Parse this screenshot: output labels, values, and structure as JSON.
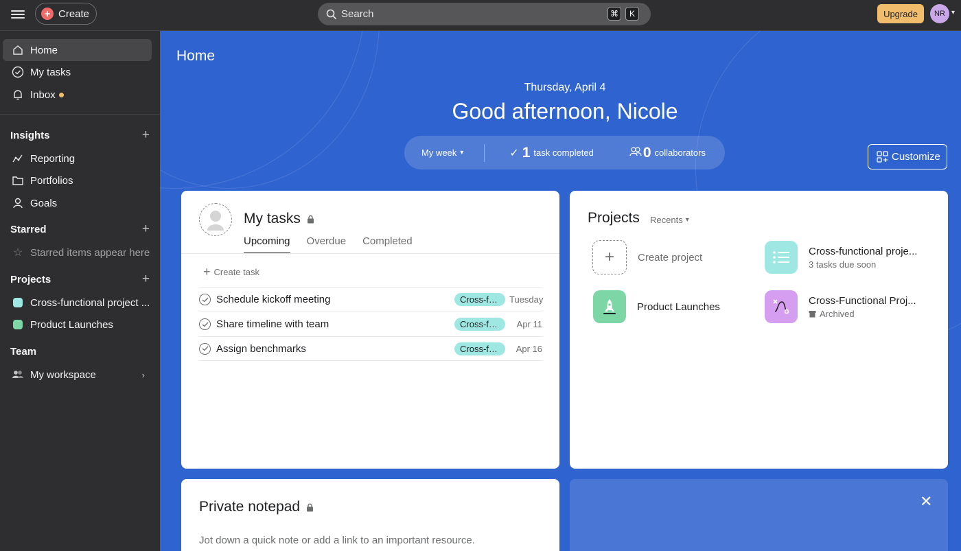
{
  "topbar": {
    "create_label": "Create",
    "search_placeholder": "Search",
    "shortcut_cmd": "⌘",
    "shortcut_key": "K",
    "upgrade_label": "Upgrade",
    "avatar_initials": "NR"
  },
  "sidebar": {
    "nav": [
      {
        "label": "Home",
        "icon": "home-icon",
        "active": true
      },
      {
        "label": "My tasks",
        "icon": "check-circle-icon"
      },
      {
        "label": "Inbox",
        "icon": "bell-icon",
        "badge": "unread-dot"
      }
    ],
    "insights": {
      "title": "Insights",
      "items": [
        {
          "label": "Reporting",
          "icon": "reporting-icon"
        },
        {
          "label": "Portfolios",
          "icon": "folder-icon"
        },
        {
          "label": "Goals",
          "icon": "goals-icon"
        }
      ]
    },
    "starred": {
      "title": "Starred",
      "empty_text": "Starred items appear here"
    },
    "projects": {
      "title": "Projects",
      "items": [
        {
          "label": "Cross-functional project ...",
          "color": "#9ee7e3"
        },
        {
          "label": "Product Launches",
          "color": "#7cd6a5"
        }
      ]
    },
    "team": {
      "title": "Team",
      "items": [
        {
          "label": "My workspace",
          "icon": "team-icon"
        }
      ]
    }
  },
  "main": {
    "title": "Home",
    "date": "Thursday, April 4",
    "greeting": "Good afternoon, Nicole",
    "stats": {
      "period": "My week",
      "tasks_completed_count": "1",
      "tasks_completed_label": "task completed",
      "collaborators_count": "0",
      "collaborators_label": "collaborators"
    },
    "customize_label": "Customize",
    "accent_color": "#2f63cf"
  },
  "my_tasks": {
    "title": "My tasks",
    "tabs": [
      "Upcoming",
      "Overdue",
      "Completed"
    ],
    "create_task_label": "Create task",
    "tasks": [
      {
        "name": "Schedule kickoff meeting",
        "tag": "Cross-fu...",
        "due": "Tuesday"
      },
      {
        "name": "Share timeline with team",
        "tag": "Cross-fu...",
        "due": "Apr 11"
      },
      {
        "name": "Assign benchmarks",
        "tag": "Cross-fu...",
        "due": "Apr 16"
      }
    ]
  },
  "projects_card": {
    "title": "Projects",
    "filter": "Recents",
    "create_label": "Create project",
    "items": [
      {
        "name": "Cross-functional proje...",
        "sub": "3 tasks due soon",
        "color": "#9ee7e3"
      },
      {
        "name": "Product Launches",
        "sub": "",
        "color": "#7cd6a5"
      },
      {
        "name": "Cross-Functional Proj...",
        "sub": "Archived",
        "color": "#d59ef0"
      }
    ]
  },
  "notepad": {
    "title": "Private notepad",
    "placeholder": "Jot down a quick note or add a link to an important resource."
  }
}
